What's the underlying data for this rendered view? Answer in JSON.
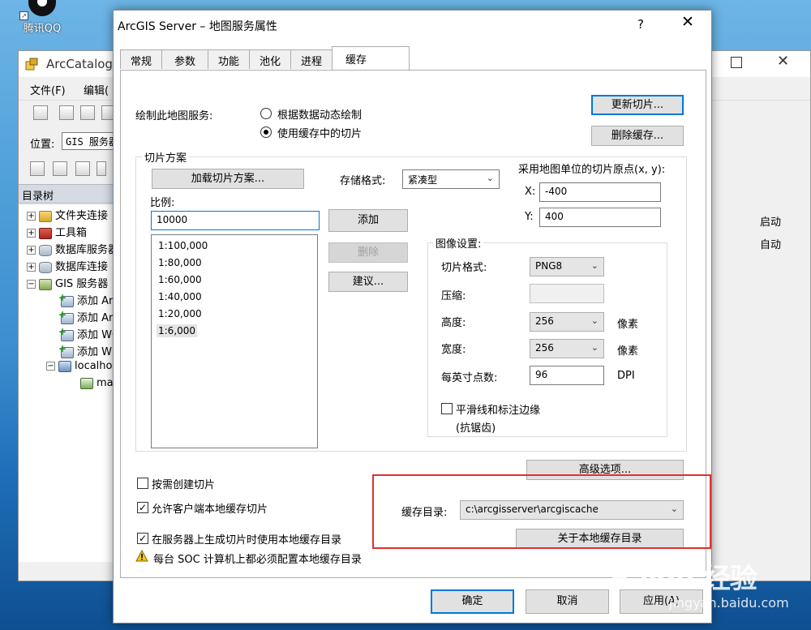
{
  "desktop": {
    "qq_label": "腾讯QQ"
  },
  "catalog": {
    "title": "ArcCatalog",
    "menu": [
      "文件(F)",
      "编辑("
    ],
    "location_label": "位置:",
    "location_value": "GIS 服务器",
    "tree_header": "目录树",
    "tree": [
      {
        "label": "文件夹连接",
        "icon": "folder-icon",
        "expander": "+"
      },
      {
        "label": "工具箱",
        "icon": "toolbox-icon",
        "expander": "+"
      },
      {
        "label": "数据库服务器",
        "icon": "database-icon",
        "expander": "+"
      },
      {
        "label": "数据库连接",
        "icon": "database-icon",
        "expander": "+"
      },
      {
        "label": "GIS 服务器",
        "icon": "gis-server-icon",
        "expander": "−"
      },
      {
        "label": "添加 ArcGIS",
        "icon": "add-server-icon"
      },
      {
        "label": "添加 ArcIMS",
        "icon": "add-server-icon"
      },
      {
        "label": "添加 WCS",
        "icon": "add-server-icon"
      },
      {
        "label": "添加 WMS",
        "icon": "add-server-icon"
      },
      {
        "label": "localhost",
        "icon": "server-icon",
        "expander": "−"
      },
      {
        "label": "map",
        "icon": "map-service-icon"
      }
    ],
    "right_pane": [
      "启动",
      "自动"
    ]
  },
  "dialog": {
    "title": "ArcGIS Server – 地图服务属性",
    "help": "?",
    "close": "✕",
    "tabs": [
      "常规",
      "参数",
      "功能",
      "池化",
      "进程",
      "缓存"
    ],
    "active_tab": "缓存",
    "draw_label": "绘制此地图服务:",
    "radio_dynamic": "根据数据动态绘制",
    "radio_cache": "使用缓存中的切片",
    "update_tiles": "更新切片...",
    "delete_cache": "删除缓存...",
    "tiling_scheme": {
      "title": "切片方案",
      "load_button": "加载切片方案...",
      "storage_label": "存储格式:",
      "storage_value": "紧凑型",
      "origin_label": "采用地图单位的切片原点(x, y):",
      "x_label": "X:",
      "x_value": "-400",
      "y_label": "Y:",
      "y_value": "400",
      "scale_label": "比例:",
      "scale_input": "10000",
      "scales": [
        "1:100,000",
        "1:80,000",
        "1:60,000",
        "1:40,000",
        "1:20,000",
        "1:6,000"
      ],
      "add_button": "添加",
      "delete_button": "删除",
      "suggest_button": "建议...",
      "image": {
        "title": "图像设置:",
        "format_label": "切片格式:",
        "format_value": "PNG8",
        "compress_label": "压缩:",
        "compress_value": "",
        "height_label": "高度:",
        "height_value": "256",
        "width_label": "宽度:",
        "width_value": "256",
        "unit_px": "像素",
        "dpi_label": "每英寸点数:",
        "dpi_value": "96",
        "dpi_unit": "DPI",
        "antialias_line1": "平滑线和标注边缘",
        "antialias_line2": "(抗锯齿)"
      }
    },
    "on_demand": "按需创建切片",
    "allow_client_cache": "允许客户端本地缓存切片",
    "use_local_cache": "在服务器上生成切片时使用本地缓存目录",
    "warning": "每台 SOC 计算机上都必须配置本地缓存目录",
    "advanced": "高级选项...",
    "cache_dir_label": "缓存目录:",
    "cache_dir_value": "c:\\arcgisserver\\arcgiscache",
    "about_local": "关于本地缓存目录",
    "ok": "确定",
    "cancel": "取消",
    "apply": "应用(A)"
  },
  "watermark": {
    "main": "Baidu 经验",
    "sub": "jingyan.baidu.com"
  },
  "colors": {
    "accent": "#0078d7",
    "highlight": "#e03030"
  }
}
